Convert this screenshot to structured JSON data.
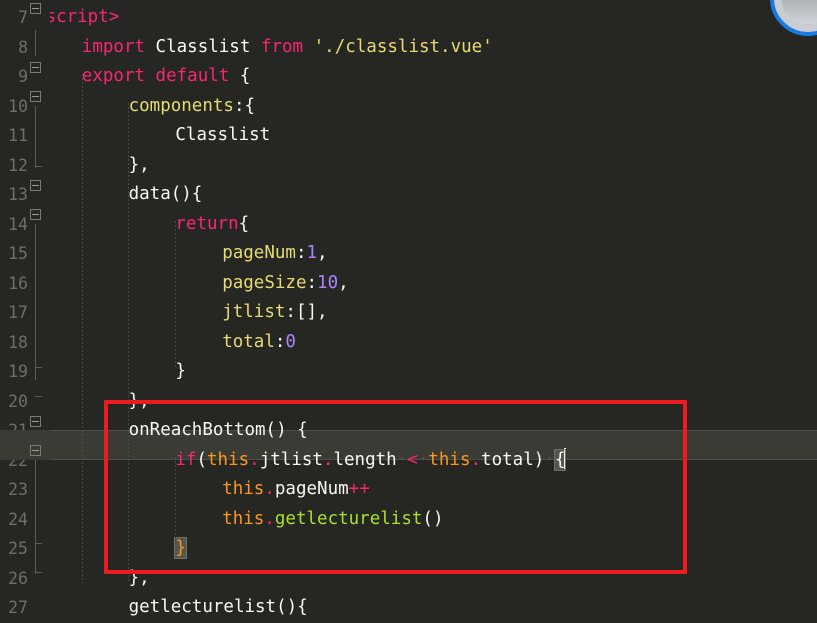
{
  "editor": {
    "theme_name": "monokai-dark",
    "background": "#262722",
    "gutter_color": "#6e7066",
    "current_line_background": "#3a3b35",
    "annotation_color": "#ee1c22"
  },
  "gutter": {
    "line_numbers": [
      "7",
      "8",
      "9",
      "10",
      "11",
      "12",
      "13",
      "14",
      "15",
      "16",
      "17",
      "18",
      "19",
      "20",
      "21",
      "22",
      "23",
      "24",
      "25",
      "26",
      "27"
    ]
  },
  "lines": [
    {
      "n": "7",
      "indent": 0,
      "tokens": [
        {
          "t": "tag",
          "v": "<script>"
        }
      ]
    },
    {
      "n": "8",
      "indent": 1,
      "tokens": [
        {
          "t": "kw",
          "v": "import"
        },
        {
          "t": "plain",
          "v": " Classlist "
        },
        {
          "t": "kw",
          "v": "from"
        },
        {
          "t": "plain",
          "v": " "
        },
        {
          "t": "str",
          "v": "'./classlist.vue'"
        }
      ]
    },
    {
      "n": "9",
      "indent": 1,
      "tokens": [
        {
          "t": "kw",
          "v": "export default"
        },
        {
          "t": "punc",
          "v": " {"
        }
      ]
    },
    {
      "n": "10",
      "indent": 2,
      "tokens": [
        {
          "t": "prop",
          "v": "components"
        },
        {
          "t": "punc",
          "v": ":{"
        }
      ]
    },
    {
      "n": "11",
      "indent": 3,
      "tokens": [
        {
          "t": "plain",
          "v": "Classlist"
        }
      ]
    },
    {
      "n": "12",
      "indent": 2,
      "tokens": [
        {
          "t": "punc",
          "v": "},"
        }
      ]
    },
    {
      "n": "13",
      "indent": 2,
      "tokens": [
        {
          "t": "plain",
          "v": "data(){"
        }
      ]
    },
    {
      "n": "14",
      "indent": 3,
      "tokens": [
        {
          "t": "kw",
          "v": "return"
        },
        {
          "t": "punc",
          "v": "{"
        }
      ]
    },
    {
      "n": "15",
      "indent": 4,
      "tokens": [
        {
          "t": "prop",
          "v": "pageNum"
        },
        {
          "t": "punc",
          "v": ":"
        },
        {
          "t": "num",
          "v": "1"
        },
        {
          "t": "punc",
          "v": ","
        }
      ]
    },
    {
      "n": "16",
      "indent": 4,
      "tokens": [
        {
          "t": "prop",
          "v": "pageSize"
        },
        {
          "t": "punc",
          "v": ":"
        },
        {
          "t": "num",
          "v": "10"
        },
        {
          "t": "punc",
          "v": ","
        }
      ]
    },
    {
      "n": "17",
      "indent": 4,
      "tokens": [
        {
          "t": "prop",
          "v": "jtlist"
        },
        {
          "t": "punc",
          "v": ":[],"
        }
      ]
    },
    {
      "n": "18",
      "indent": 4,
      "tokens": [
        {
          "t": "prop",
          "v": "total"
        },
        {
          "t": "punc",
          "v": ":"
        },
        {
          "t": "num",
          "v": "0"
        }
      ]
    },
    {
      "n": "19",
      "indent": 3,
      "tokens": [
        {
          "t": "punc",
          "v": "}"
        }
      ]
    },
    {
      "n": "20",
      "indent": 2,
      "tokens": [
        {
          "t": "punc",
          "v": "},"
        }
      ]
    },
    {
      "n": "21",
      "indent": 2,
      "tokens": [
        {
          "t": "plain",
          "v": "onReachBottom() {"
        }
      ]
    },
    {
      "n": "22",
      "indent": 3,
      "tokens": [
        {
          "t": "kw",
          "v": "if"
        },
        {
          "t": "punc",
          "v": "("
        },
        {
          "t": "this",
          "v": "this"
        },
        {
          "t": "dot",
          "v": "."
        },
        {
          "t": "plain",
          "v": "jtlist"
        },
        {
          "t": "dot",
          "v": "."
        },
        {
          "t": "plain",
          "v": "length"
        },
        {
          "t": "ws",
          "v": "·"
        },
        {
          "t": "op",
          "v": "<"
        },
        {
          "t": "ws",
          "v": "·"
        },
        {
          "t": "this",
          "v": "this"
        },
        {
          "t": "dot",
          "v": "."
        },
        {
          "t": "plain",
          "v": "total"
        },
        {
          "t": "punc",
          "v": ")"
        },
        {
          "t": "ws",
          "v": "·"
        },
        {
          "t": "bracematch",
          "v": "{"
        },
        {
          "t": "cursor",
          "v": ""
        }
      ]
    },
    {
      "n": "23",
      "indent": 4,
      "tokens": [
        {
          "t": "this",
          "v": "this"
        },
        {
          "t": "dot",
          "v": "."
        },
        {
          "t": "plain",
          "v": "pageNum"
        },
        {
          "t": "op",
          "v": "++"
        }
      ]
    },
    {
      "n": "24",
      "indent": 4,
      "tokens": [
        {
          "t": "this",
          "v": "this"
        },
        {
          "t": "dot",
          "v": "."
        },
        {
          "t": "fn",
          "v": "getlecturelist"
        },
        {
          "t": "punc",
          "v": "()"
        }
      ]
    },
    {
      "n": "25",
      "indent": 3,
      "tokens": [
        {
          "t": "bracematch-o",
          "v": "}"
        }
      ]
    },
    {
      "n": "26",
      "indent": 2,
      "tokens": [
        {
          "t": "punc",
          "v": "},"
        }
      ]
    },
    {
      "n": "27",
      "indent": 2,
      "tokens": [
        {
          "t": "plain",
          "v": "getlecturelist(){"
        }
      ]
    }
  ],
  "folds": {
    "markers_on_lines": [
      "7",
      "9",
      "10",
      "13",
      "14",
      "21",
      "22"
    ]
  },
  "annotation": {
    "type": "red-rectangle-highlight",
    "covers_lines": [
      "21",
      "22",
      "23",
      "24",
      "25",
      "26"
    ],
    "color": "#ee1c22"
  },
  "cursor": {
    "line": "22",
    "after_token": "{"
  },
  "badge": {
    "name": "circular-overlay-icon",
    "ring_color": "#1b7ae0"
  }
}
